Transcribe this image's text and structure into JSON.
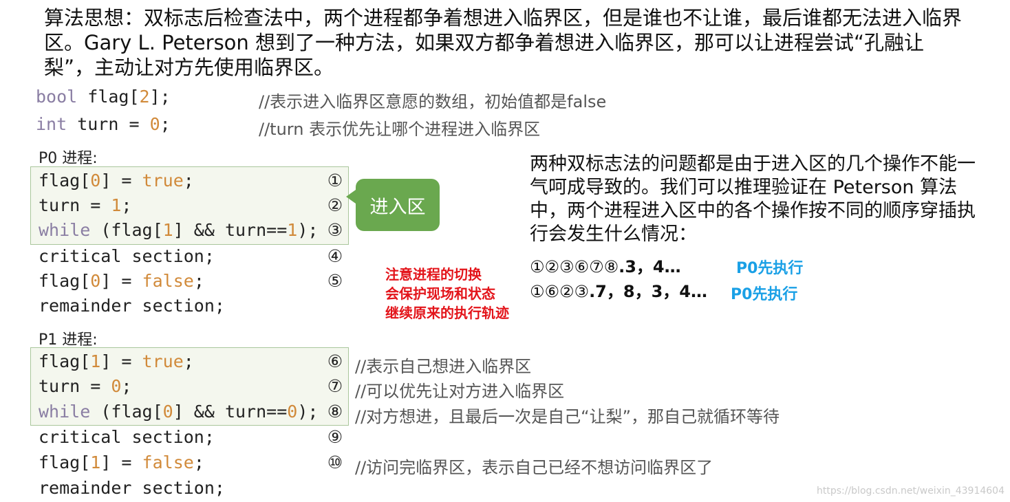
{
  "intro": "算法思想：双标志后检查法中，两个进程都争着想进入临界区，但是谁也不让谁，最后谁都无法进入临界区。Gary L. Peterson 想到了一种方法，如果双方都争着想进入临界区，那可以让进程尝试“孔融让梨”，主动让对方先使用临界区。",
  "decl": {
    "line1": {
      "type": "bool",
      "rest": " flag[",
      "num": "2",
      "tail": "];",
      "comment": "//表示进入临界区意愿的数组，初始值都是false"
    },
    "line2": {
      "type": "int",
      "rest": " turn = ",
      "num": "0",
      "tail": ";",
      "comment": "//turn 表示优先让哪个进程进入临界区"
    }
  },
  "p0": {
    "title": "P0 进程:",
    "l1a": "flag[",
    "l1n": "0",
    "l1b": "] = ",
    "l1v": "true",
    "l1c": ";",
    "c1": "①",
    "l2a": "turn = ",
    "l2n": "1",
    "l2c": ";",
    "c2": "②",
    "l3k": "while",
    "l3a": " (flag[",
    "l3n": "1",
    "l3b": "] && turn==",
    "l3m": "1",
    "l3c": ");",
    "c3": "③",
    "l4": "critical section;",
    "c4": "④",
    "l5a": "flag[",
    "l5n": "0",
    "l5b": "] = ",
    "l5v": "false",
    "l5c": ";",
    "c5": "⑤",
    "l6": "remainder section;"
  },
  "p1": {
    "title": "P1 进程:",
    "l1a": "flag[",
    "l1n": "1",
    "l1b": "] = ",
    "l1v": "true",
    "l1c": ";",
    "c1": "⑥",
    "cm1": "//表示自己想进入临界区",
    "l2a": "turn = ",
    "l2n": "0",
    "l2c": ";",
    "c2": "⑦",
    "cm2": "//可以优先让对方进入临界区",
    "l3k": "while",
    "l3a": " (flag[",
    "l3n": "0",
    "l3b": "] && turn==",
    "l3m": "0",
    "l3c": ");",
    "c3": "⑧",
    "cm3": "//对方想进，且最后一次是自己“让梨”，那自己就循环等待",
    "l4": "critical section;",
    "c4": "⑨",
    "l5a": "flag[",
    "l5n": "1",
    "l5b": "] = ",
    "l5v": "false",
    "l5c": ";",
    "c5": "⑩",
    "cm5": "//访问完临界区，表示自己已经不想访问临界区了",
    "l6": "remainder section;"
  },
  "bubble": "进入区",
  "note": "两种双标志法的问题都是由于进入区的几个操作不能一气呵成导致的。我们可以推理验证在 Peterson 算法中，两个进程进入区中的各个操作按不同的顺序穿插执行会发生什么情况：",
  "red_note": [
    "注意进程的切换",
    "会保护现场和状态",
    "继续原来的执行轨迹"
  ],
  "seq1": {
    "circled": "①②③⑥⑦⑧",
    "tail": ".3，4…",
    "label": "P0先执行"
  },
  "seq2": {
    "circled": "①⑥②③",
    "tail": ".7，8，3，4…",
    "label": "P0先执行"
  },
  "watermark": "https://blog.csdn.net/weixin_43914604",
  "colors": {
    "keyword": "#8a7ea3",
    "literal": "#d18a3a",
    "highlight_border": "#a9c69b",
    "bubble": "#6aa84f",
    "red": "#e3141a",
    "blue": "#1aa0e6"
  }
}
